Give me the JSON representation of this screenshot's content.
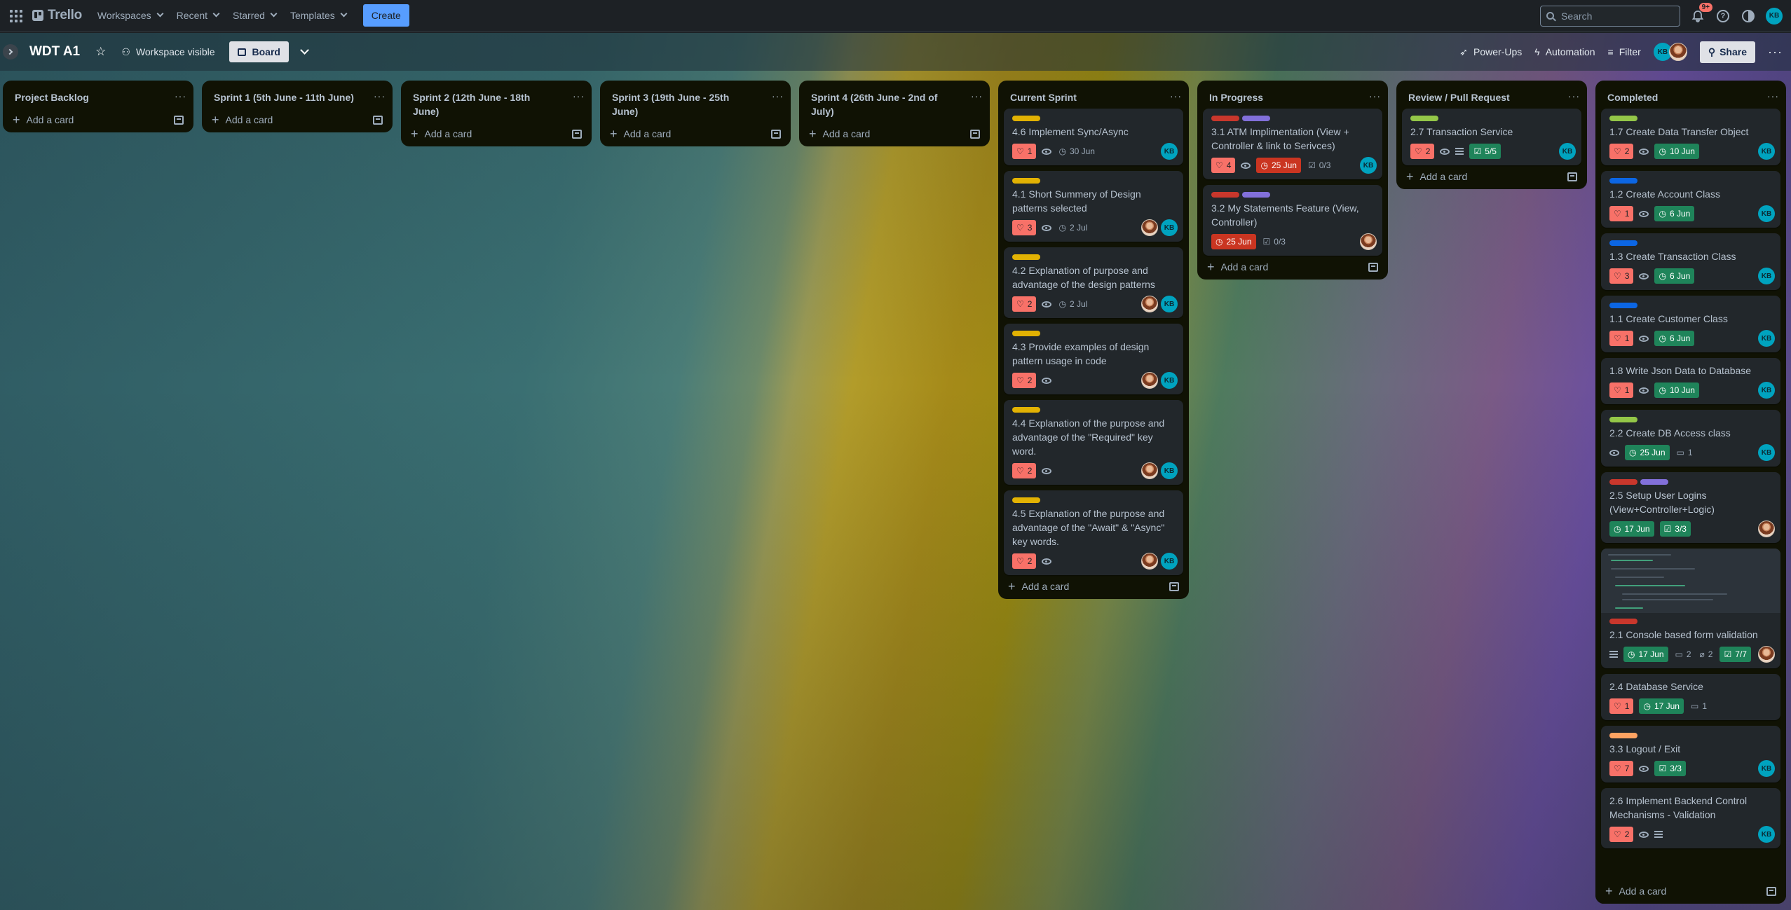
{
  "nav": {
    "logo": "Trello",
    "menus": [
      "Workspaces",
      "Recent",
      "Starred",
      "Templates"
    ],
    "create": "Create",
    "search_placeholder": "Search",
    "notifications_badge": "9+",
    "help_icon": "?",
    "user_initials": "KB"
  },
  "board": {
    "title": "WDT A1",
    "visibility": "Workspace visible",
    "view": "Board",
    "power_ups": "Power-Ups",
    "automation": "Automation",
    "filter": "Filter",
    "share": "Share",
    "member_initials": "KB"
  },
  "add_card": "Add a card",
  "colors": {
    "yellow": "#e2b203",
    "red": "#c9372c",
    "purple": "#8270db",
    "green": "#94c748",
    "blue": "#0c66e4",
    "orange": "#fea362",
    "teal": "#4bce97"
  },
  "lists": [
    {
      "title": "Project Backlog",
      "cards": []
    },
    {
      "title": "Sprint 1 (5th June - 11th June)",
      "cards": []
    },
    {
      "title": "Sprint 2 (12th June - 18th June)",
      "cards": []
    },
    {
      "title": "Sprint 3 (19th June - 25th June)",
      "cards": []
    },
    {
      "title": "Sprint 4 (26th June - 2nd of July)",
      "cards": []
    },
    {
      "title": "Current Sprint",
      "cards": [
        {
          "labels": [
            "yellow"
          ],
          "title": "4.6 Implement Sync/Async",
          "votes": "1",
          "watch": true,
          "date": "30 Jun",
          "members": [
            "kb"
          ]
        },
        {
          "labels": [
            "yellow"
          ],
          "title": "4.1 Short Summery of Design patterns selected",
          "votes": "3",
          "watch": true,
          "date": "2 Jul",
          "members": [
            "photo",
            "kb"
          ]
        },
        {
          "labels": [
            "yellow"
          ],
          "title": "4.2 Explanation of purpose and advantage of the design patterns",
          "votes": "2",
          "watch": true,
          "date": "2 Jul",
          "members": [
            "photo",
            "kb"
          ]
        },
        {
          "labels": [
            "yellow"
          ],
          "title": "4.3 Provide examples of design pattern usage in code",
          "votes": "2",
          "watch": true,
          "members": [
            "photo",
            "kb"
          ]
        },
        {
          "labels": [
            "yellow"
          ],
          "title": "4.4 Explanation of the purpose and advantage of the \"Required\" key word.",
          "votes": "2",
          "watch": true,
          "members": [
            "photo",
            "kb"
          ]
        },
        {
          "labels": [
            "yellow"
          ],
          "title": "4.5 Explanation of the purpose and advantage of the \"Await\" & \"Async\" key words.",
          "votes": "2",
          "watch": true,
          "members": [
            "photo",
            "kb"
          ]
        }
      ]
    },
    {
      "title": "In Progress",
      "cards": [
        {
          "labels": [
            "red",
            "purple"
          ],
          "title": "3.1 ATM Implimentation (View + Controller & link to Serivces)",
          "votes": "4",
          "watch": true,
          "due_red": "25 Jun",
          "checklist": "0/3",
          "members": [
            "kb"
          ]
        },
        {
          "labels": [
            "red",
            "purple"
          ],
          "title": "3.2 My Statements Feature (View, Controller)",
          "due_red": "25 Jun",
          "checklist": "0/3",
          "members": [
            "photo"
          ]
        }
      ]
    },
    {
      "title": "Review / Pull Request",
      "cards": [
        {
          "labels": [
            "green"
          ],
          "title": "2.7 Transaction Service",
          "votes": "2",
          "watch": true,
          "description": true,
          "check_green": "5/5",
          "members": [
            "kb"
          ]
        }
      ]
    },
    {
      "title": "Completed",
      "cards": [
        {
          "labels": [
            "green"
          ],
          "title": "1.7 Create Data Transfer Object",
          "votes": "2",
          "watch": true,
          "due_green": "10 Jun",
          "members": [
            "kb"
          ]
        },
        {
          "labels": [
            "blue"
          ],
          "title": "1.2 Create Account Class",
          "votes": "1",
          "watch": true,
          "due_green": "6 Jun",
          "members": [
            "kb"
          ]
        },
        {
          "labels": [
            "blue"
          ],
          "title": "1.3 Create Transaction Class",
          "votes": "3",
          "watch": true,
          "due_green": "6 Jun",
          "members": [
            "kb"
          ]
        },
        {
          "labels": [
            "blue"
          ],
          "title": "1.1 Create Customer Class",
          "votes": "1",
          "watch": true,
          "due_green": "6 Jun",
          "members": [
            "kb"
          ]
        },
        {
          "labels": [],
          "title": "1.8 Write Json Data to Database",
          "votes": "1",
          "watch": true,
          "due_green": "10 Jun",
          "members": [
            "kb"
          ]
        },
        {
          "labels": [
            "green"
          ],
          "title": "2.2 Create DB Access class",
          "watch": true,
          "due_green": "25 Jun",
          "comments": "1",
          "members": [
            "kb"
          ]
        },
        {
          "labels": [
            "red",
            "purple"
          ],
          "title": "2.5 Setup User Logins (View+Controller+Logic)",
          "due_green": "17 Jun",
          "check_green": "3/3",
          "members": [
            "photo"
          ]
        },
        {
          "cover": true,
          "labels": [
            "red"
          ],
          "title": "2.1 Console based form validation",
          "due_green": "17 Jun",
          "description": true,
          "comments": "2",
          "attachments": "2",
          "check_green": "7/7",
          "members": [
            "photo"
          ]
        },
        {
          "labels": [],
          "title": "2.4 Database Service",
          "votes": "1",
          "due_green": "17 Jun",
          "comments": "1",
          "members": []
        },
        {
          "labels": [
            "orange"
          ],
          "title": "3.3 Logout / Exit",
          "votes": "7",
          "watch": true,
          "check_green": "3/3",
          "members": [
            "kb"
          ]
        },
        {
          "labels": [],
          "title": "2.6 Implement Backend Control Mechanisms - Validation",
          "votes": "2",
          "watch": true,
          "description": true,
          "members": [
            "kb"
          ]
        }
      ]
    }
  ]
}
